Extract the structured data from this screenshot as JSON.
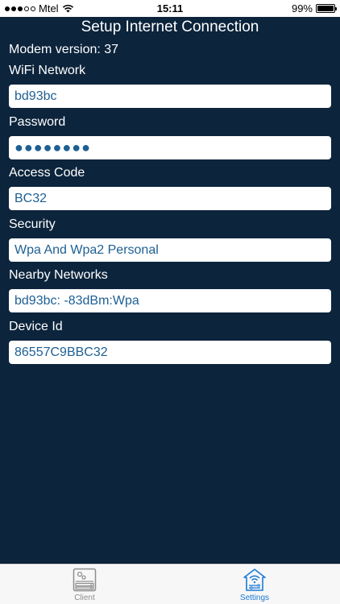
{
  "status_bar": {
    "carrier": "Mtel",
    "time": "15:11",
    "battery": "99%",
    "battery_level": 0.99
  },
  "header": {
    "title": "Setup Internet Connection"
  },
  "modem_version": "Modem version: 37",
  "fields": [
    {
      "label": "WiFi Network",
      "value": "bd93bc"
    },
    {
      "label": "Password",
      "value": "●●●●●●●●"
    },
    {
      "label": "Access Code",
      "value": "BC32"
    },
    {
      "label": "Security",
      "value": "Wpa And Wpa2 Personal"
    },
    {
      "label": "Nearby Networks",
      "value": "bd93bc:  -83dBm:Wpa"
    },
    {
      "label": "Device Id",
      "value": "86557C9BBC32"
    }
  ],
  "tabs": [
    {
      "label": "Client",
      "icon": "client-server-icon",
      "active": false
    },
    {
      "label": "Settings",
      "icon": "wifi-router-icon",
      "active": true
    }
  ],
  "colors": {
    "background": "#0c243c",
    "input_text": "#1d5f93",
    "tab_active": "#1a7ad8",
    "tab_inactive": "#8e8e8e"
  }
}
